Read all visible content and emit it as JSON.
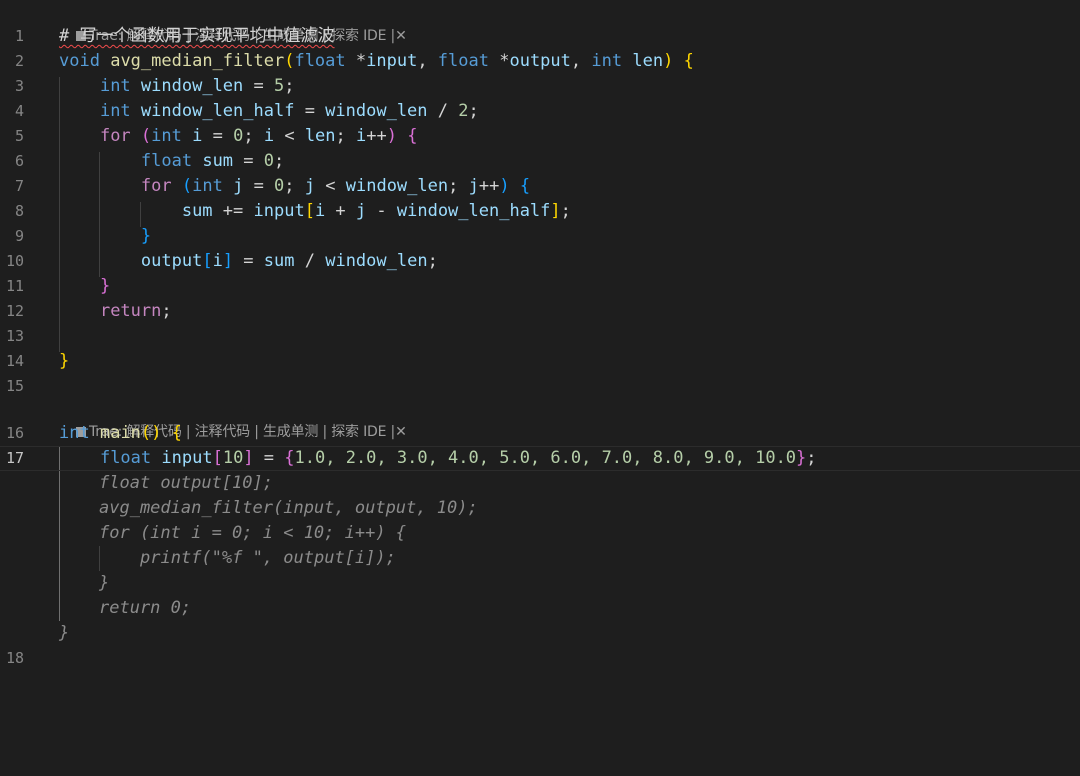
{
  "code_lens": {
    "brand": "Trae:",
    "actions": [
      "解释代码",
      "注释代码",
      "生成单测",
      "探索 IDE"
    ],
    "separator": "|",
    "close_glyph": "✕"
  },
  "line_numbers": [
    "1",
    "2",
    "3",
    "4",
    "5",
    "6",
    "7",
    "8",
    "9",
    "10",
    "11",
    "12",
    "13",
    "14",
    "15",
    "16",
    "17",
    "18"
  ],
  "lines": {
    "l1": {
      "comment": "# 写一个函数用于实现平均中值滤波"
    },
    "l2": {
      "type_void": "void",
      "func_name": "avg_median_filter",
      "open_paren": "(",
      "type_float_a": "float",
      "star_a": " *",
      "param_input": "input",
      "comma_a": ", ",
      "type_float_b": "float",
      "star_b": " *",
      "param_output": "output",
      "comma_b": ", ",
      "type_int": "int",
      "param_len": "len",
      "close_paren": ")",
      "open_brace": "{"
    },
    "l3": {
      "type": "int",
      "name": "window_len",
      "op": " = ",
      "value": "5",
      "semi": ";"
    },
    "l4": {
      "type": "int",
      "name": "window_len_half",
      "op": " = ",
      "ref": "window_len",
      "div": " / ",
      "value": "2",
      "semi": ";"
    },
    "l5": {
      "kw": "for",
      "paren_open": "(",
      "type": "int",
      "var_i": "i",
      "init": " = ",
      "zero": "0",
      "semi1": "; ",
      "var_i2": "i",
      "lt": " < ",
      "var_len": "len",
      "semi2": "; ",
      "var_i3": "i",
      "inc": "++",
      "paren_close": ")",
      "brace": "{"
    },
    "l6": {
      "type": "float",
      "name": "sum",
      "op": " = ",
      "value": "0",
      "semi": ";"
    },
    "l7": {
      "kw": "for",
      "paren_open": "(",
      "type": "int",
      "var_j": "j",
      "init": " = ",
      "zero": "0",
      "semi1": "; ",
      "var_j2": "j",
      "lt": " < ",
      "var_wl": "window_len",
      "semi2": "; ",
      "var_j3": "j",
      "inc": "++",
      "paren_close": ")",
      "brace": "{"
    },
    "l8": {
      "var_sum": "sum",
      "op": " += ",
      "var_input": "input",
      "br_open": "[",
      "var_i": "i",
      "plus": " + ",
      "var_j": "j",
      "minus": " - ",
      "var_wlh": "window_len_half",
      "br_close": "]",
      "semi": ";"
    },
    "l9": {
      "brace": "}"
    },
    "l10": {
      "var_output": "output",
      "br_open": "[",
      "var_i": "i",
      "br_close": "]",
      "op": " = ",
      "var_sum": "sum",
      "div": " / ",
      "var_wl": "window_len",
      "semi": ";"
    },
    "l11": {
      "brace": "}"
    },
    "l12": {
      "kw": "return",
      "semi": ";"
    },
    "l14": {
      "brace": "}"
    },
    "l16": {
      "type": "int",
      "func_name": "main",
      "parens": "()",
      "brace": "{"
    },
    "l17": {
      "type": "float",
      "name": "input",
      "br_open": "[",
      "size": "10",
      "br_close": "]",
      "op": " = ",
      "brace_open": "{",
      "values": "1.0, 2.0, 3.0, 4.0, 5.0, 6.0, 7.0, 8.0, 9.0, 10.0",
      "brace_close": "}",
      "semi": ";"
    }
  },
  "ghost_suggestion": {
    "g1": "float output[10];",
    "g2": "avg_median_filter(input, output, 10);",
    "g3": "for (int i = 0; i < 10; i++) {",
    "g4": "printf(\"%f \", output[i]);",
    "g5": "}",
    "g6": "return 0;",
    "g7": "}"
  }
}
